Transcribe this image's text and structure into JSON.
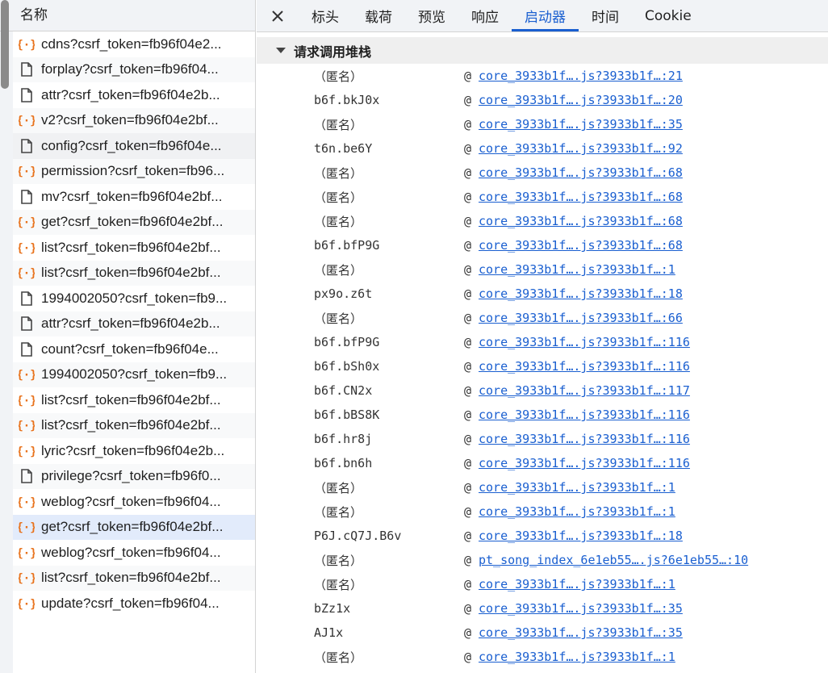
{
  "left": {
    "header": "名称",
    "requests": [
      {
        "name": "cdns?csrf_token=fb96f04e2...",
        "type": "xhr"
      },
      {
        "name": "forplay?csrf_token=fb96f04...",
        "type": "doc"
      },
      {
        "name": "attr?csrf_token=fb96f04e2b...",
        "type": "doc"
      },
      {
        "name": "v2?csrf_token=fb96f04e2bf...",
        "type": "xhr"
      },
      {
        "name": "config?csrf_token=fb96f04e...",
        "type": "doc"
      },
      {
        "name": "permission?csrf_token=fb96...",
        "type": "xhr"
      },
      {
        "name": "mv?csrf_token=fb96f04e2bf...",
        "type": "doc"
      },
      {
        "name": "get?csrf_token=fb96f04e2bf...",
        "type": "xhr"
      },
      {
        "name": "list?csrf_token=fb96f04e2bf...",
        "type": "xhr"
      },
      {
        "name": "list?csrf_token=fb96f04e2bf...",
        "type": "xhr"
      },
      {
        "name": "1994002050?csrf_token=fb9...",
        "type": "doc"
      },
      {
        "name": "attr?csrf_token=fb96f04e2b...",
        "type": "doc"
      },
      {
        "name": "count?csrf_token=fb96f04e...",
        "type": "doc"
      },
      {
        "name": "1994002050?csrf_token=fb9...",
        "type": "xhr"
      },
      {
        "name": "list?csrf_token=fb96f04e2bf...",
        "type": "xhr"
      },
      {
        "name": "list?csrf_token=fb96f04e2bf...",
        "type": "xhr"
      },
      {
        "name": "lyric?csrf_token=fb96f04e2b...",
        "type": "xhr"
      },
      {
        "name": "privilege?csrf_token=fb96f0...",
        "type": "doc"
      },
      {
        "name": "weblog?csrf_token=fb96f04...",
        "type": "xhr"
      },
      {
        "name": "get?csrf_token=fb96f04e2bf...",
        "type": "xhr"
      },
      {
        "name": "weblog?csrf_token=fb96f04...",
        "type": "xhr"
      },
      {
        "name": "list?csrf_token=fb96f04e2bf...",
        "type": "xhr"
      },
      {
        "name": "update?csrf_token=fb96f04...",
        "type": "xhr"
      }
    ]
  },
  "tabs": [
    "标头",
    "载荷",
    "预览",
    "响应",
    "启动器",
    "时间",
    "Cookie"
  ],
  "active_tab": "启动器",
  "section_title": "请求调用堆栈",
  "stack": [
    {
      "fn": "（匿名）",
      "at": "@",
      "link": "core_3933b1f….js?3933b1f…:21"
    },
    {
      "fn": "b6f.bkJ0x",
      "at": "@",
      "link": "core_3933b1f….js?3933b1f…:20"
    },
    {
      "fn": "（匿名）",
      "at": "@",
      "link": "core_3933b1f….js?3933b1f…:35"
    },
    {
      "fn": "t6n.be6Y",
      "at": "@",
      "link": "core_3933b1f….js?3933b1f…:92"
    },
    {
      "fn": "（匿名）",
      "at": "@",
      "link": "core_3933b1f….js?3933b1f…:68"
    },
    {
      "fn": "（匿名）",
      "at": "@",
      "link": "core_3933b1f….js?3933b1f…:68"
    },
    {
      "fn": "（匿名）",
      "at": "@",
      "link": "core_3933b1f….js?3933b1f…:68"
    },
    {
      "fn": "b6f.bfP9G",
      "at": "@",
      "link": "core_3933b1f….js?3933b1f…:68"
    },
    {
      "fn": "（匿名）",
      "at": "@",
      "link": "core_3933b1f….js?3933b1f…:1"
    },
    {
      "fn": "px9o.z6t",
      "at": "@",
      "link": "core_3933b1f….js?3933b1f…:18"
    },
    {
      "fn": "（匿名）",
      "at": "@",
      "link": "core_3933b1f….js?3933b1f…:66"
    },
    {
      "fn": "b6f.bfP9G",
      "at": "@",
      "link": "core_3933b1f….js?3933b1f…:116"
    },
    {
      "fn": "b6f.bSh0x",
      "at": "@",
      "link": "core_3933b1f….js?3933b1f…:116"
    },
    {
      "fn": "b6f.CN2x",
      "at": "@",
      "link": "core_3933b1f….js?3933b1f…:117"
    },
    {
      "fn": "b6f.bBS8K",
      "at": "@",
      "link": "core_3933b1f….js?3933b1f…:116"
    },
    {
      "fn": "b6f.hr8j",
      "at": "@",
      "link": "core_3933b1f….js?3933b1f…:116"
    },
    {
      "fn": "b6f.bn6h",
      "at": "@",
      "link": "core_3933b1f….js?3933b1f…:116"
    },
    {
      "fn": "（匿名）",
      "at": "@",
      "link": "core_3933b1f….js?3933b1f…:1"
    },
    {
      "fn": "（匿名）",
      "at": "@",
      "link": "core_3933b1f….js?3933b1f…:1"
    },
    {
      "fn": "P6J.cQ7J.B6v",
      "at": "@",
      "link": "core_3933b1f….js?3933b1f…:18"
    },
    {
      "fn": "（匿名）",
      "at": "@",
      "link": "pt_song_index_6e1eb55….js?6e1eb55…:10"
    },
    {
      "fn": "（匿名）",
      "at": "@",
      "link": "core_3933b1f….js?3933b1f…:1"
    },
    {
      "fn": "bZz1x",
      "at": "@",
      "link": "core_3933b1f….js?3933b1f…:35"
    },
    {
      "fn": "AJ1x",
      "at": "@",
      "link": "core_3933b1f….js?3933b1f…:35"
    },
    {
      "fn": "（匿名）",
      "at": "@",
      "link": "core_3933b1f….js?3933b1f…:1"
    }
  ],
  "colors": {
    "accent": "#1a5fd0",
    "xhr_icon": "#e8711a",
    "doc_icon": "#444444",
    "selected_row": "#e2ebfb"
  },
  "icons": {
    "xhr": "braces-icon",
    "doc": "document-icon",
    "close": "close-icon",
    "expand": "triangle-down-icon"
  }
}
